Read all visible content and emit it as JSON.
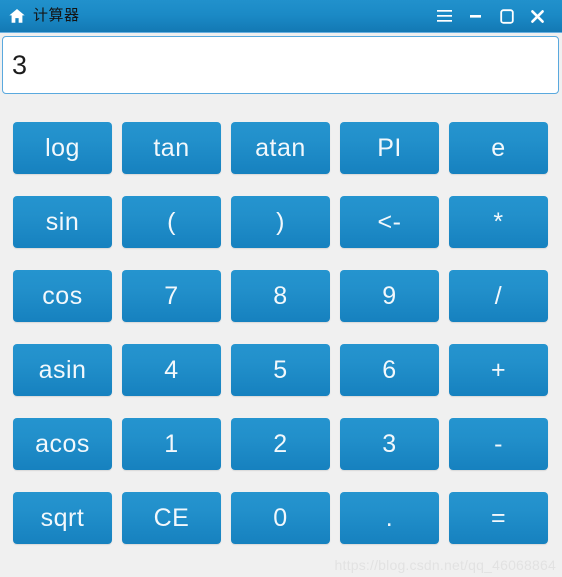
{
  "window": {
    "title": "计算器",
    "home_icon": "home-icon",
    "controls": [
      {
        "name": "menu-button",
        "icon": "hamburger-menu-icon"
      },
      {
        "name": "minimize-button",
        "icon": "minimize-icon"
      },
      {
        "name": "maximize-button",
        "icon": "maximize-icon"
      },
      {
        "name": "close-button",
        "icon": "close-icon"
      }
    ],
    "colors": {
      "titlebar_top": "#2191cc",
      "titlebar_bottom": "#1379b4",
      "body_background": "#f0f0f0",
      "button_top": "#2594cf",
      "button_bottom": "#1681bf",
      "button_text": "#f2f8fc",
      "input_border": "#5aa9de"
    }
  },
  "display": {
    "value": "3",
    "placeholder": ""
  },
  "keypad": {
    "rows": [
      [
        "log",
        "tan",
        "atan",
        "PI",
        "e"
      ],
      [
        "sin",
        "(",
        ")",
        "<-",
        "*"
      ],
      [
        "cos",
        "7",
        "8",
        "9",
        "/"
      ],
      [
        "asin",
        "4",
        "5",
        "6",
        "+"
      ],
      [
        "acos",
        "1",
        "2",
        "3",
        "-"
      ],
      [
        "sqrt",
        "CE",
        "0",
        ".",
        "="
      ]
    ]
  },
  "watermark": {
    "text": "https://blog.csdn.net/qq_46068864"
  }
}
